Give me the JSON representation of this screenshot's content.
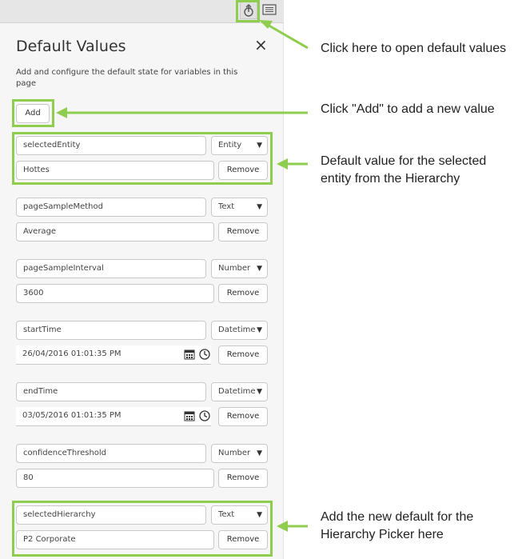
{
  "colors": {
    "accent": "#8fcd4e",
    "panel": "#f6f6f6"
  },
  "toolbar": {
    "defaults_icon": "default-values-icon",
    "list_icon": "list-view-icon"
  },
  "panel": {
    "title": "Default Values",
    "close": "×",
    "description": "Add and configure the default state for variables in this page",
    "add_label": "Add",
    "remove_label": "Remove",
    "variables": [
      {
        "name": "selectedEntity",
        "type": "Entity",
        "value": "Hottes"
      },
      {
        "name": "pageSampleMethod",
        "type": "Text",
        "value": "Average"
      },
      {
        "name": "pageSampleInterval",
        "type": "Number",
        "value": "3600"
      },
      {
        "name": "startTime",
        "type": "Datetime",
        "value": "26/04/2016 01:01:35 PM"
      },
      {
        "name": "endTime",
        "type": "Datetime",
        "value": "03/05/2016 01:01:35 PM"
      },
      {
        "name": "confidenceThreshold",
        "type": "Number",
        "value": "80"
      },
      {
        "name": "selectedHierarchy",
        "type": "Text",
        "value": "P2 Corporate"
      }
    ]
  },
  "callouts": {
    "open_defaults": "Click here to open default values",
    "add_value": "Click \"Add\" to add a new value",
    "entity_default": "Default value for the selected entity from the Hierarchy",
    "hierarchy_default": "Add the new default for the Hierarchy Picker here"
  }
}
